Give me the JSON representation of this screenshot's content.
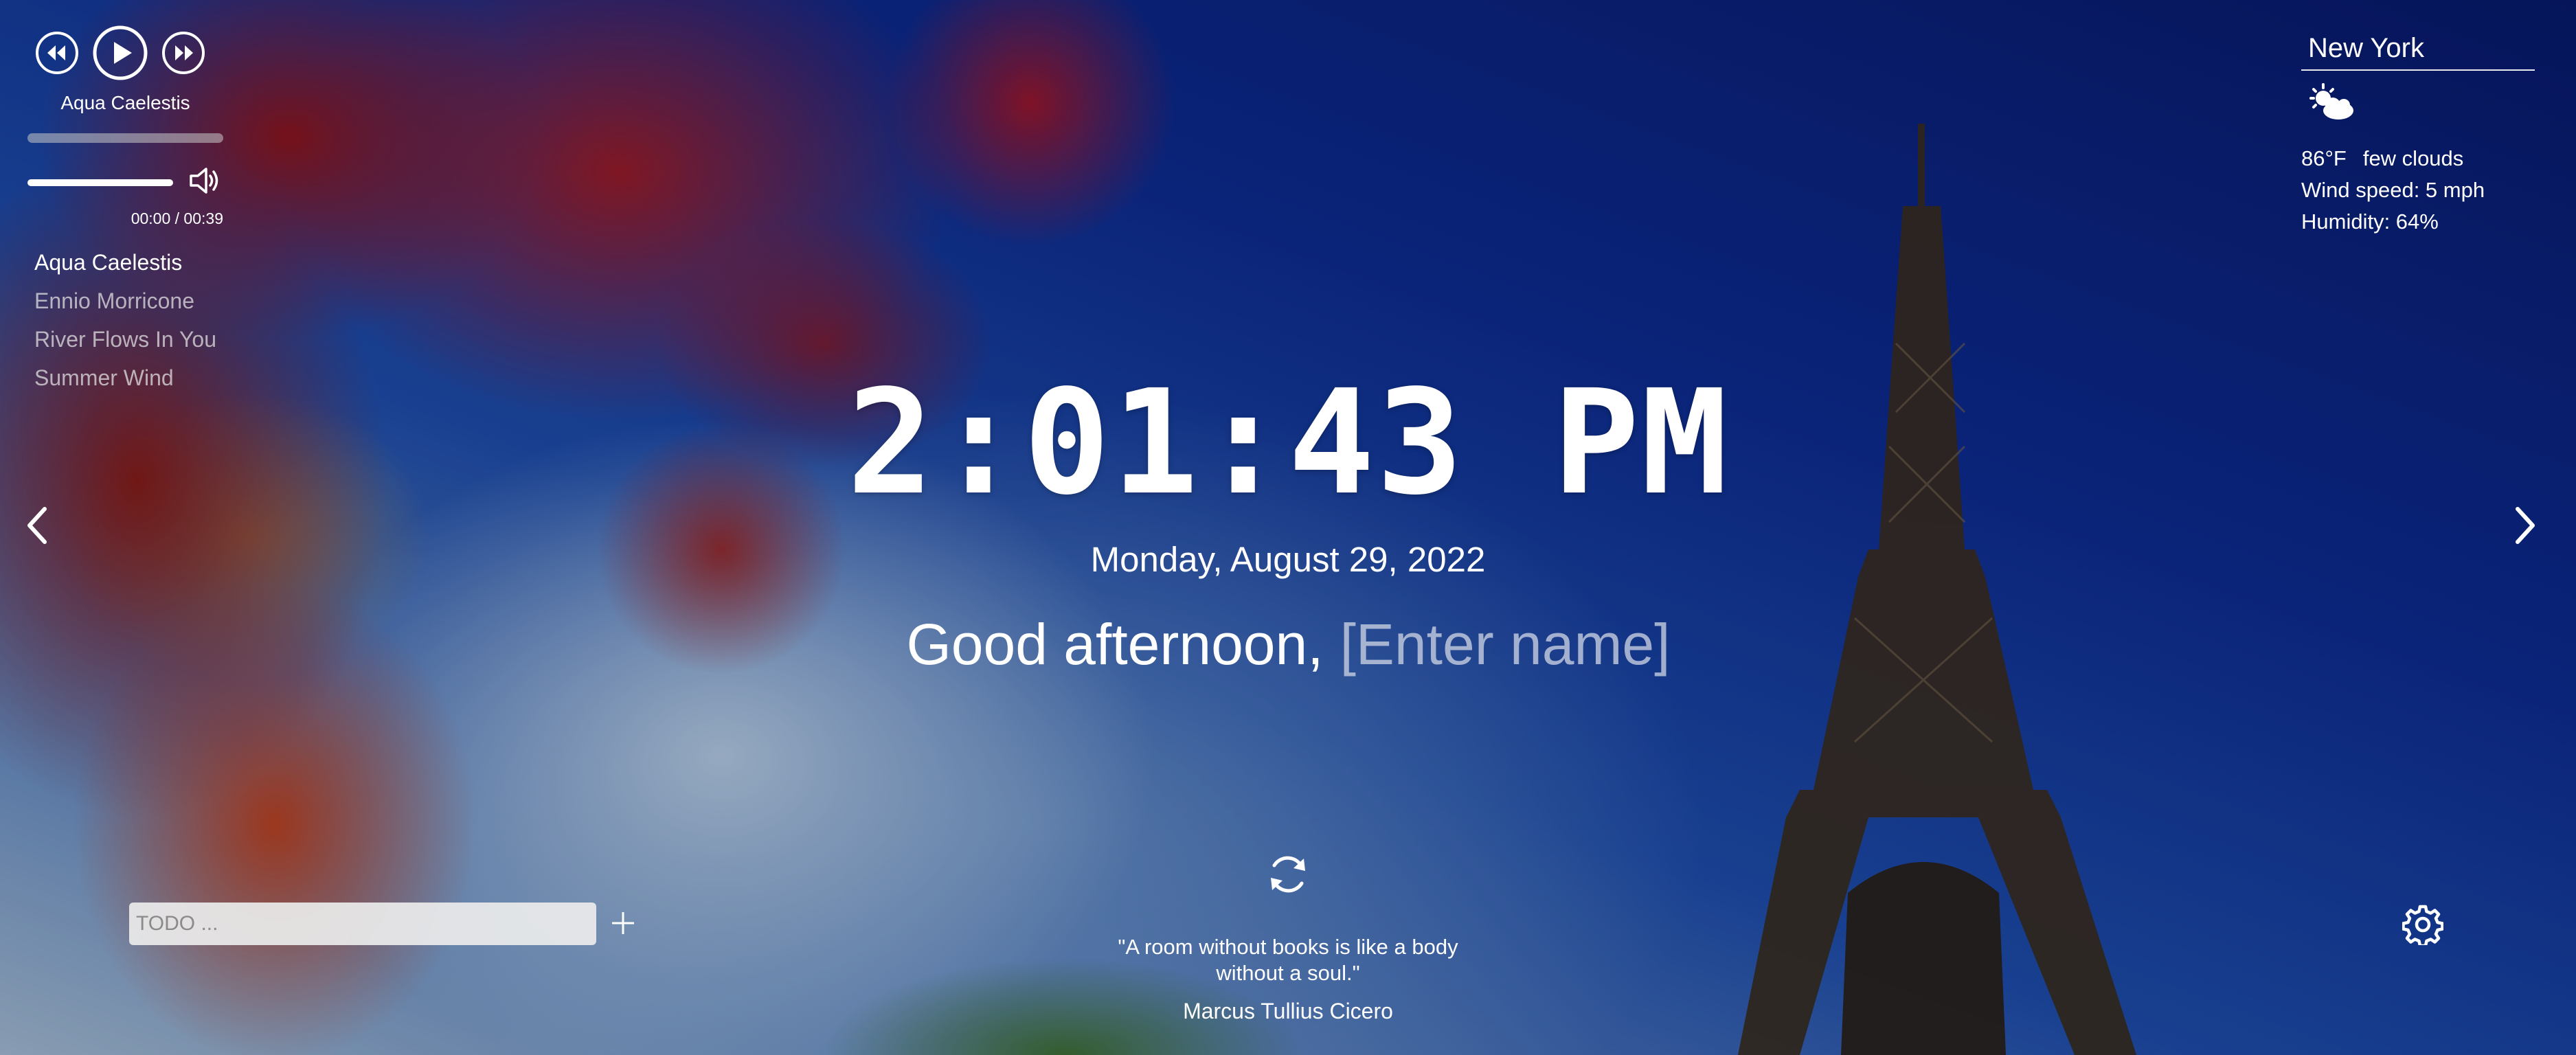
{
  "player": {
    "current_track": "Aqua Caelestis",
    "progress": 0.0,
    "volume": 0.8,
    "time": "00:00 / 00:39",
    "playlist": [
      {
        "title": "Aqua Caelestis",
        "active": true
      },
      {
        "title": "Ennio Morricone",
        "active": false
      },
      {
        "title": "River Flows In You",
        "active": false
      },
      {
        "title": "Summer Wind",
        "active": false
      }
    ]
  },
  "weather": {
    "city": "New York",
    "icon": "few-clouds-icon",
    "temperature": "86°F",
    "description": "few clouds",
    "wind": "Wind speed: 5 mph",
    "humidity": "Humidity: 64%"
  },
  "clock": {
    "time": "2:01:43 PM",
    "date": "Monday, August 29, 2022"
  },
  "greeting": {
    "text": "Good afternoon,",
    "name_placeholder": "[Enter name]"
  },
  "quote": {
    "text": "\"A room without books is like a body without a soul.\"",
    "author": "Marcus Tullius Cicero"
  },
  "todo": {
    "placeholder": "TODO ..."
  },
  "colors": {
    "text": "#ffffff",
    "muted_text": "#d0d4e0",
    "todo_bg": "#ebebeb"
  }
}
